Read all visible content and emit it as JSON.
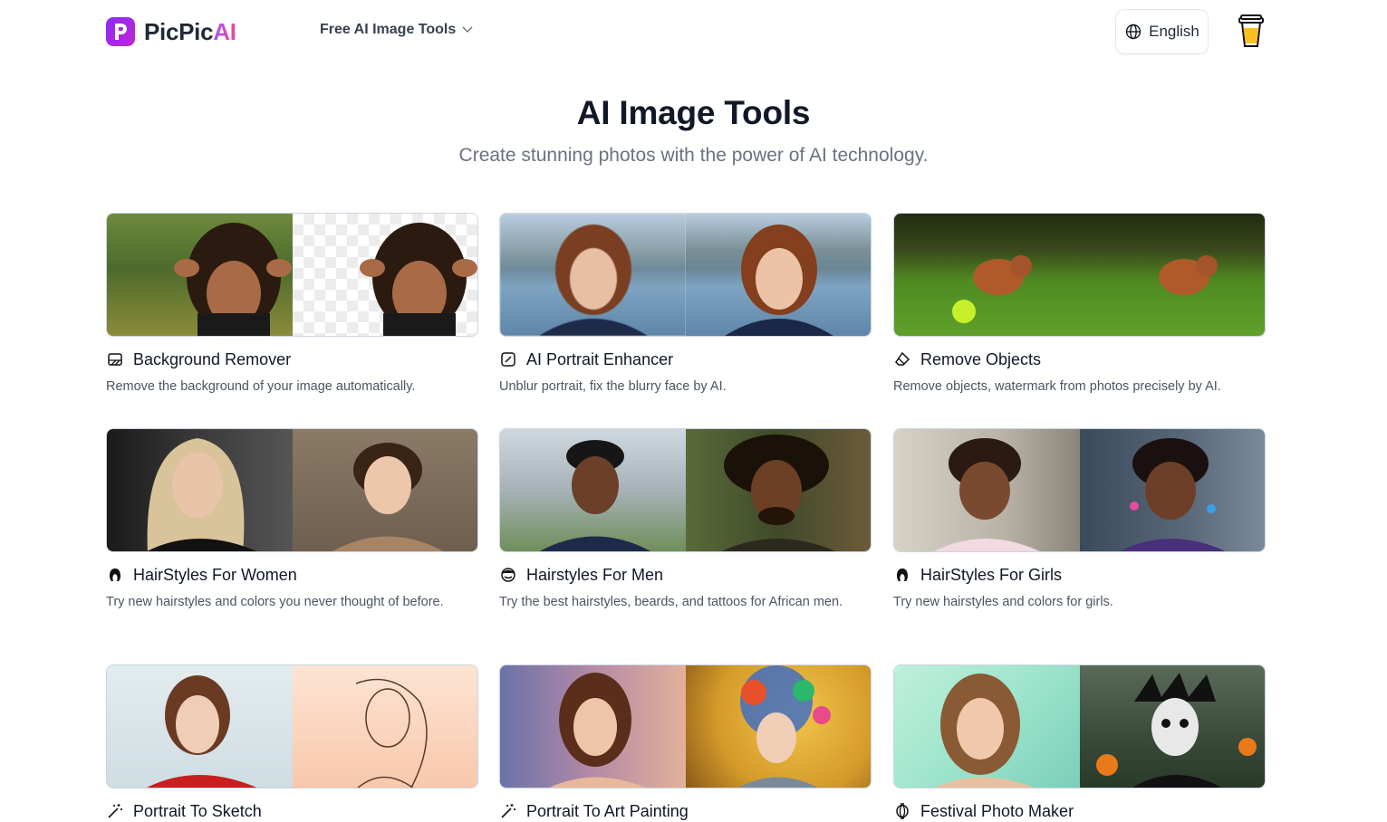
{
  "brand": {
    "name_main": "PicPic",
    "name_accent": "AI",
    "accent_color": "#a855f7"
  },
  "nav": {
    "tools_label": "Free AI Image Tools"
  },
  "language": {
    "label": "English"
  },
  "hero": {
    "title": "AI Image Tools",
    "subtitle": "Create stunning photos with the power of AI technology."
  },
  "tools": [
    {
      "title": "Background Remover",
      "desc": "Remove the background of your image automatically.",
      "icon": "background-remove-icon"
    },
    {
      "title": "AI Portrait Enhancer",
      "desc": "Unblur portrait, fix the blurry face by AI.",
      "icon": "enhance-icon"
    },
    {
      "title": "Remove Objects",
      "desc": "Remove objects, watermark from photos precisely by AI.",
      "icon": "eraser-icon"
    },
    {
      "title": "HairStyles For Women",
      "desc": "Try new hairstyles and colors you never thought of before.",
      "icon": "woman-hair-icon"
    },
    {
      "title": "Hairstyles For Men",
      "desc": "Try the best hairstyles, beards, and tattoos for African men.",
      "icon": "man-hair-icon"
    },
    {
      "title": "HairStyles For Girls",
      "desc": "Try new hairstyles and colors for girls.",
      "icon": "girl-hair-icon"
    },
    {
      "title": "Portrait To Sketch",
      "desc": "",
      "icon": "magic-wand-icon"
    },
    {
      "title": "Portrait To Art Painting",
      "desc": "",
      "icon": "magic-wand-icon"
    },
    {
      "title": "Festival Photo Maker",
      "desc": "",
      "icon": "lantern-icon"
    }
  ]
}
